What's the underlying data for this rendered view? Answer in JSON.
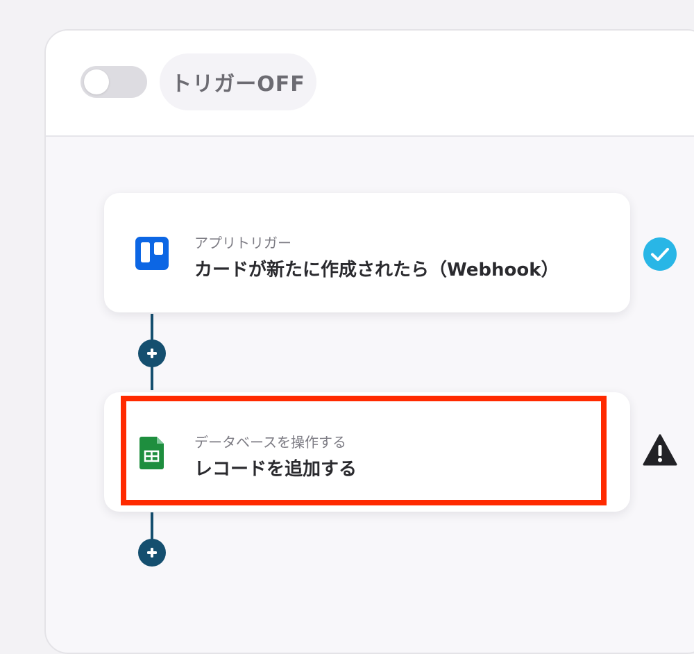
{
  "header": {
    "toggle_state": "off",
    "trigger_label": "トリガーOFF"
  },
  "steps": [
    {
      "category": "アプリトリガー",
      "title": "カードが新たに作成されたら（Webhook）",
      "icon": "trello-icon",
      "status": "check-circle-icon",
      "accent_color": "#0c66e4"
    },
    {
      "category": "データベースを操作する",
      "title": "レコードを追加する",
      "icon": "google-sheets-icon",
      "status": "warning-icon",
      "accent_color": "#1e8e3e"
    }
  ],
  "colors": {
    "connector": "#154f6f",
    "success": "#29b6e6",
    "highlight": "#ff2a00"
  }
}
